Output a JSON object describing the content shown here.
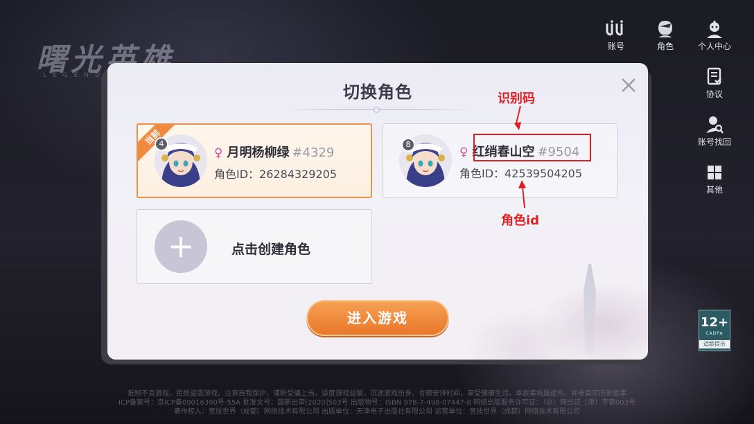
{
  "background": {
    "logo": "曙光英雄",
    "logo_sub": "LEGEND",
    "footer_lines": [
      "抵制不良游戏，拒绝盗版游戏。注意自我保护，谨防受骗上当。适度游戏益脑，沉迷游戏伤身。合理安排时间，享受健康生活。本故事纯属虚构，并非真实历史故事",
      "ICP备案号：京ICP备09016390号-55A  批准文号：国新出审[2020]503号  出版物号：ISBN 978-7-498-07447-8  网络出版服务许可证：（总）网出证（津）字第003号",
      "著作权人：竞技世界（成都）网络技术有限公司  出版单位：天津电子出版社有限公司  运营单位：竞技世界（成都）网络技术有限公司"
    ]
  },
  "side_menu": [
    {
      "label": "账号",
      "icon": "account-icon"
    },
    {
      "label": "角色",
      "icon": "character-icon"
    },
    {
      "label": "个人中心",
      "icon": "personal-center-icon"
    },
    {
      "label": "协议",
      "icon": "agreement-icon"
    },
    {
      "label": "账号找回",
      "icon": "account-recovery-icon"
    },
    {
      "label": "其他",
      "icon": "grid-icon"
    }
  ],
  "age_rating": {
    "value": "12+",
    "org": "CADPA",
    "tip": "适龄提示"
  },
  "modal": {
    "title": "切换角色",
    "close_icon": "close-icon",
    "current_badge": "当前",
    "characters": [
      {
        "level": "4",
        "name": "月明杨柳绿",
        "code": "#4329",
        "role_id": "角色ID：26284329205",
        "gender": "female"
      },
      {
        "level": "8",
        "name": "红绡春山空",
        "code": "#9504",
        "role_id": "角色ID：42539504205",
        "gender": "female"
      }
    ],
    "create_label": "点击创建角色",
    "enter_button": "进入游戏"
  },
  "annotations": {
    "code_label": "识别码",
    "id_label": "角色id",
    "color": "#e02020"
  },
  "colors": {
    "accent_orange": "#ef9148",
    "gender_female": "#d44aa8"
  }
}
